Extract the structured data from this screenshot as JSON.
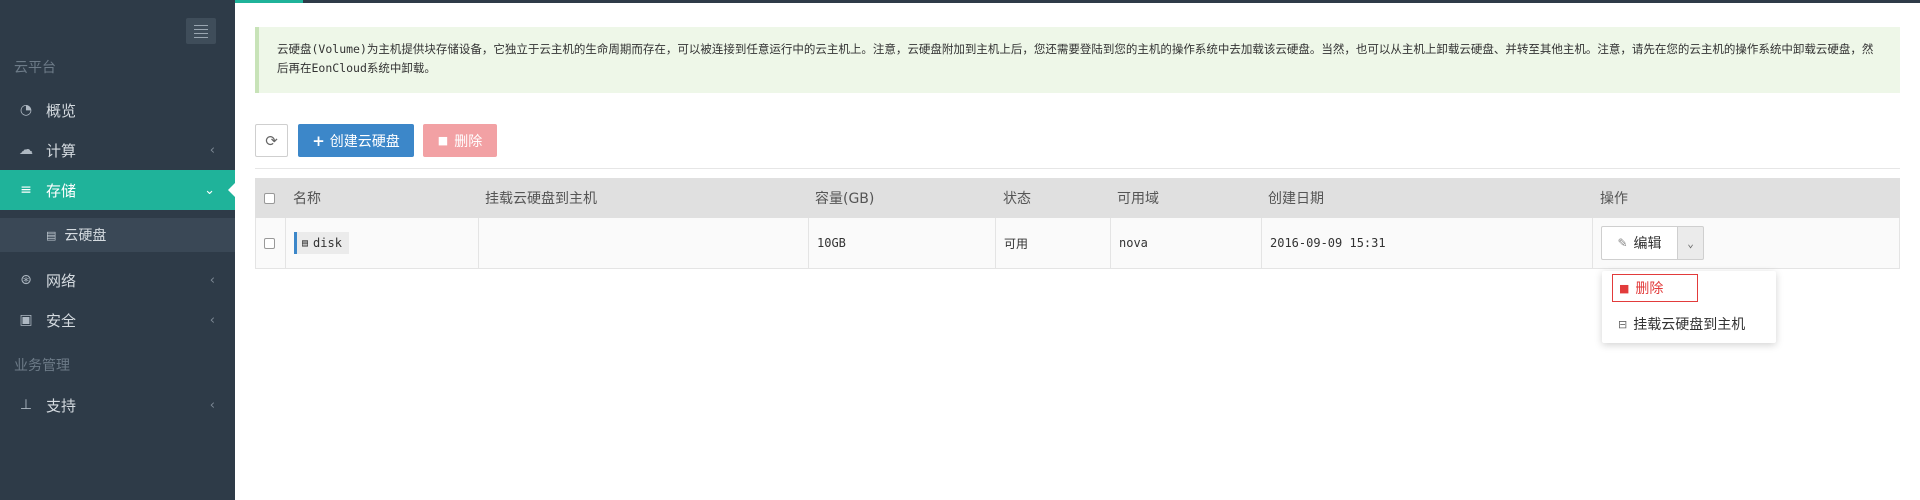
{
  "sidebar": {
    "section_cloud": "云平台",
    "section_business": "业务管理",
    "items": {
      "overview": {
        "label": "概览",
        "icon": "dashboard-icon"
      },
      "compute": {
        "label": "计算",
        "icon": "cloud-icon"
      },
      "storage": {
        "label": "存储",
        "icon": "database-icon"
      },
      "network": {
        "label": "网络",
        "icon": "network-icon"
      },
      "security": {
        "label": "安全",
        "icon": "briefcase-icon"
      },
      "support": {
        "label": "支持",
        "icon": "pin-icon"
      }
    },
    "sub_items": {
      "volume": {
        "label": "云硬盘",
        "icon": "database-icon"
      }
    }
  },
  "info": {
    "text": "云硬盘(Volume)为主机提供块存储设备，它独立于云主机的生命周期而存在，可以被连接到任意运行中的云主机上。注意，云硬盘附加到主机上后，您还需要登陆到您的主机的操作系统中去加载该云硬盘。当然，也可以从主机上卸载云硬盘、并转至其他主机。注意，请先在您的云主机的操作系统中卸载云硬盘，然后再在EonCloud系统中卸载。"
  },
  "toolbar": {
    "refresh_icon": "refresh-icon",
    "create_label": "创建云硬盘",
    "delete_label": "删除"
  },
  "table": {
    "headers": {
      "name": "名称",
      "attach": "挂载云硬盘到主机",
      "capacity": "容量(GB)",
      "status": "状态",
      "zone": "可用域",
      "created": "创建日期",
      "actions": "操作"
    },
    "rows": [
      {
        "name": "disk",
        "attach": "",
        "capacity": "10GB",
        "status": "可用",
        "zone": "nova",
        "created": "2016-09-09 15:31",
        "action_label": "编辑"
      }
    ]
  },
  "dropdown": {
    "delete_label": "删除",
    "attach_label": "挂载云硬盘到主机"
  },
  "colors": {
    "sidebar_bg": "#2e3b48",
    "accent": "#1fb39a",
    "primary": "#3c87c9",
    "danger": "#e23b3b",
    "info_bg": "#eef7e8"
  }
}
